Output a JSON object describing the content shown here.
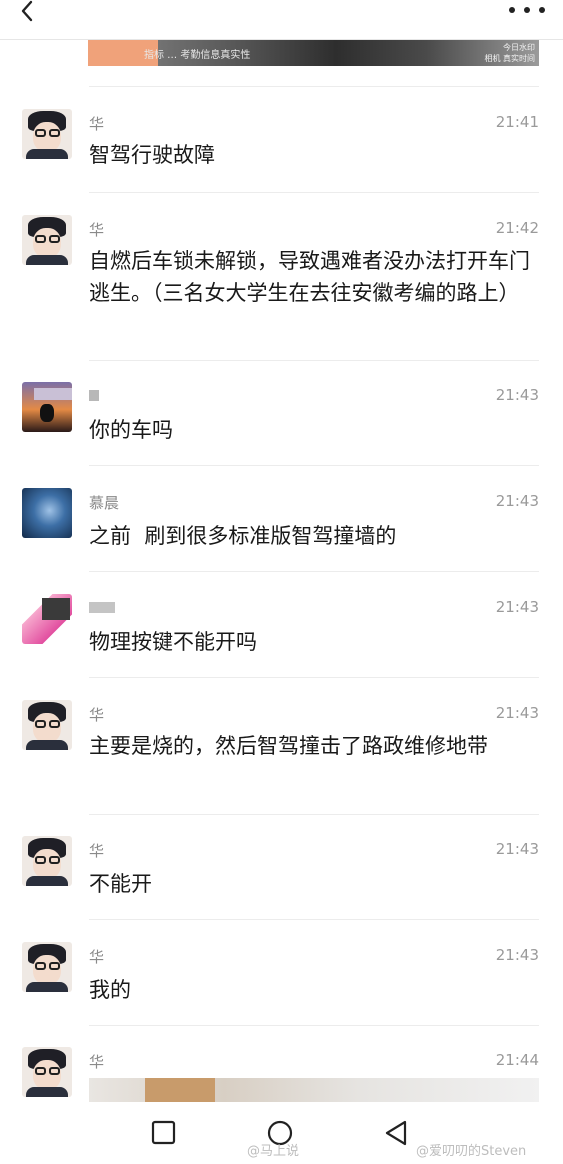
{
  "top_image": {
    "caption": "指标 … 考勤信息真实性",
    "stamp_line1": "今日水印",
    "stamp_line2": "相机 真实时间"
  },
  "messages": [
    {
      "sender": "华",
      "time": "21:41",
      "text": "智驾行驶故障"
    },
    {
      "sender": "华",
      "time": "21:42",
      "text": "自燃后车锁未解锁，导致遇难者没办法打开车门逃生。（三名女大学生在去往安徽考编的路上）"
    },
    {
      "sender": "",
      "time": "21:43",
      "text": "你的车吗"
    },
    {
      "sender": "慕晨",
      "time": "21:43",
      "text": "之前  刷到很多标准版智驾撞墙的"
    },
    {
      "sender": "",
      "time": "21:43",
      "text": "物理按键不能开吗"
    },
    {
      "sender": "华",
      "time": "21:43",
      "text": "主要是烧的，然后智驾撞击了路政维修地带"
    },
    {
      "sender": "华",
      "time": "21:43",
      "text": "不能开"
    },
    {
      "sender": "华",
      "time": "21:43",
      "text": "我的"
    },
    {
      "sender": "华",
      "time": "21:44",
      "text": ""
    }
  ],
  "watermarks": {
    "left": "@马上说",
    "right": "@爱叨叨的Steven"
  },
  "icons": {
    "back": "chevron-left-icon",
    "more": "more-dots-icon",
    "nav_recent": "square-icon",
    "nav_home": "circle-icon",
    "nav_back": "triangle-back-icon"
  }
}
